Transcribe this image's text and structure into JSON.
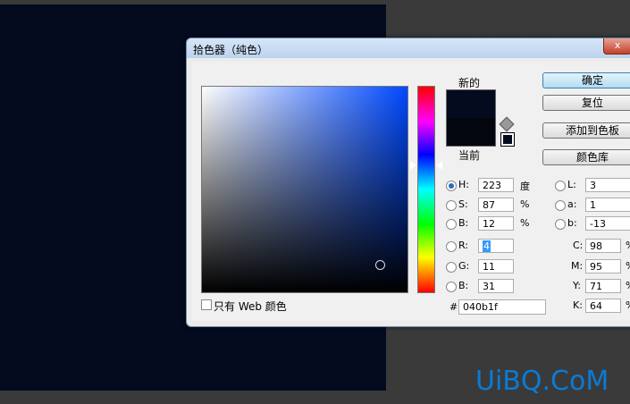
{
  "dialog": {
    "title": "拾色器（纯色）",
    "close_label": "x"
  },
  "swatches": {
    "new_label": "新的",
    "current_label": "当前",
    "new_color": "#040b1f",
    "current_color": "#03060f"
  },
  "buttons": {
    "ok": "确定",
    "reset": "复位",
    "add_to_swatches": "添加到色板",
    "color_libraries": "颜色库"
  },
  "hsb": {
    "h_label": "H:",
    "h_value": "223",
    "h_unit": "度",
    "s_label": "S:",
    "s_value": "87",
    "s_unit": "%",
    "b_label": "B:",
    "b_value": "12",
    "b_unit": "%"
  },
  "rgb": {
    "r_label": "R:",
    "r_value": "4",
    "g_label": "G:",
    "g_value": "11",
    "b_label": "B:",
    "b_value": "31"
  },
  "lab": {
    "l_label": "L:",
    "l_value": "3",
    "a_label": "a:",
    "a_value": "1",
    "b_label": "b:",
    "b_value": "-13"
  },
  "cmyk": {
    "c_label": "C:",
    "c_value": "98",
    "m_label": "M:",
    "m_value": "95",
    "y_label": "Y:",
    "y_value": "71",
    "k_label": "K:",
    "k_value": "64",
    "unit": "%"
  },
  "hex": {
    "label": "#",
    "value": "040b1f"
  },
  "web_only": {
    "label": "只有 Web 颜色",
    "checked": false
  },
  "selected_mode": "H",
  "hue_degrees": 223,
  "watermark": "UiBQ.CoM",
  "colors": {
    "canvas": "#040b1f",
    "selection": "#3399ff",
    "watermark": "#0a7bd6"
  }
}
